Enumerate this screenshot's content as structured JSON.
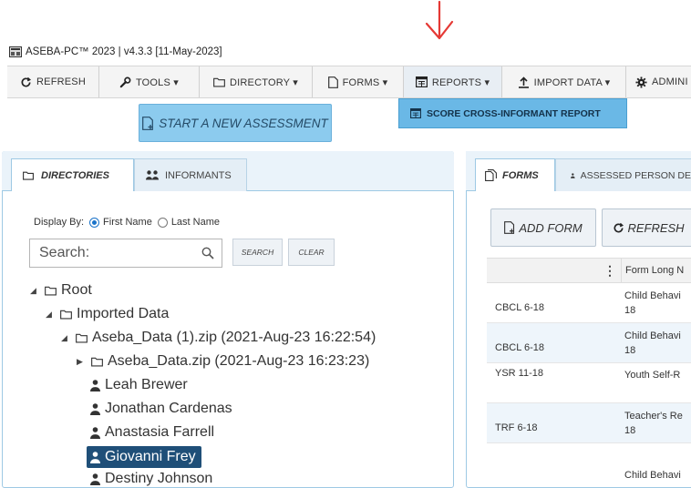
{
  "window": {
    "title": "ASEBA-PC™ 2023 | v4.3.3 [11-May-2023]"
  },
  "toolbar": {
    "refresh": "REFRESH",
    "tools": "TOOLS ▾",
    "directory": "DIRECTORY ▾",
    "forms": "FORMS ▾",
    "reports": "REPORTS ▾",
    "import_data": "IMPORT DATA ▾",
    "admin": "ADMINI"
  },
  "reports_menu": {
    "score_cross_informant": "SCORE CROSS-INFORMANT REPORT"
  },
  "start_assessment": "START A NEW ASSESSMENT",
  "left_tabs": {
    "directories": "DIRECTORIES",
    "informants": "INFORMANTS"
  },
  "display_by": {
    "label": "Display By:",
    "first_name": "First Name",
    "last_name": "Last Name"
  },
  "search": {
    "placeholder": "Search:",
    "search_btn": "SEARCH",
    "clear_btn": "CLEAR"
  },
  "tree": {
    "root": "Root",
    "imported": "Imported Data",
    "zip1": "Aseba_Data (1).zip (2021-Aug-23 16:22:54)",
    "zip2": "Aseba_Data.zip (2021-Aug-23 16:23:23)",
    "people": [
      "Leah Brewer",
      "Jonathan Cardenas",
      "Anastasia Farrell",
      "Giovanni Frey",
      "Destiny Johnson"
    ]
  },
  "right_tabs": {
    "forms": "FORMS",
    "assessed": "ASSESSED PERSON DE"
  },
  "right_buttons": {
    "add_form": "ADD FORM",
    "refresh": "REFRESH"
  },
  "grid": {
    "col_header": "Form Long N",
    "rows": [
      {
        "form": "CBCL 6-18",
        "long": "Child Behavi 18"
      },
      {
        "form": "CBCL 6-18",
        "long": "Child Behavi 18"
      },
      {
        "form": "YSR 11-18",
        "long": "Youth Self-R"
      },
      {
        "form": "TRF 6-18",
        "long": "Teacher's Re 18"
      },
      {
        "form": "",
        "long": "Child Behavi"
      }
    ]
  },
  "colors": {
    "accent": "#6ab8e6",
    "selected": "#1f4f78",
    "annotation": "#e53935"
  }
}
